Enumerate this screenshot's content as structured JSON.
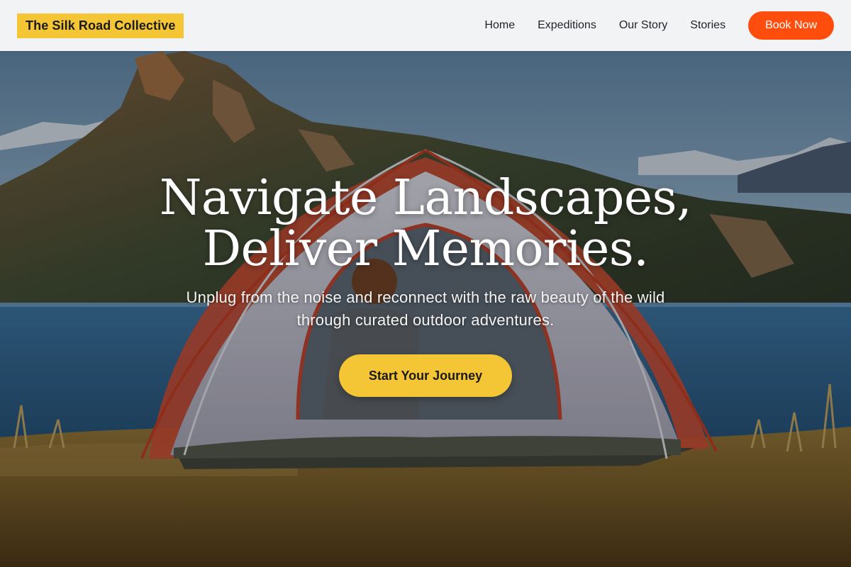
{
  "brand": {
    "name": "The Silk Road Collective"
  },
  "nav": {
    "links": [
      "Home",
      "Expeditions",
      "Our Story",
      "Stories"
    ],
    "cta_label": "Book Now"
  },
  "hero": {
    "headline_line1": "Navigate Landscapes,",
    "headline_line2": "Deliver Memories.",
    "subtitle": "Unplug from the noise and reconnect with the raw beauty of the wild through curated outdoor adventures.",
    "cta_label": "Start Your Journey",
    "background_image": "mountain-lake-tent-photo"
  },
  "colors": {
    "accent_yellow": "#f4c534",
    "accent_orange": "#ff4d0d",
    "header_bg": "#f2f3f5"
  }
}
